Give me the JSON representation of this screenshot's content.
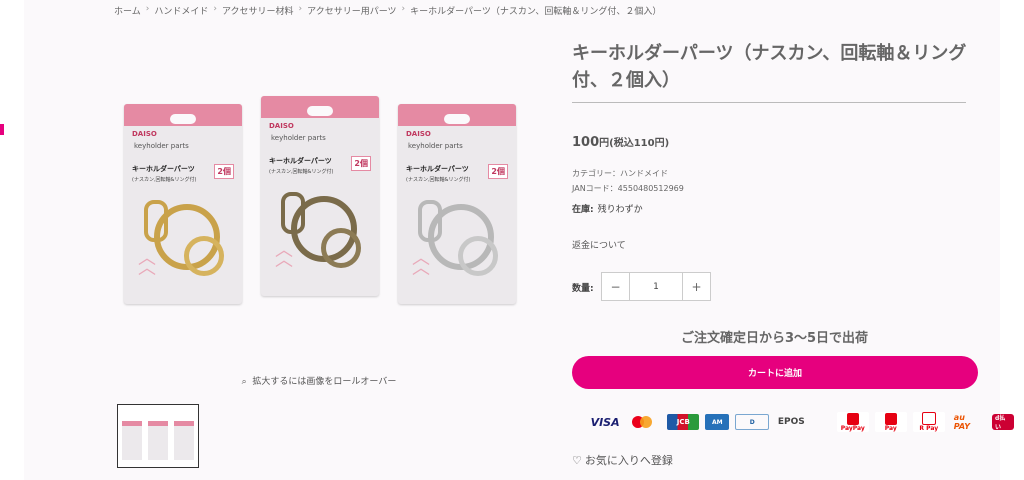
{
  "breadcrumb": [
    "ホーム",
    "ハンドメイド",
    "アクセサリー材料",
    "アクセサリー用パーツ",
    "キーホルダーパーツ（ナスカン、回転軸＆リング付、２個入）"
  ],
  "product": {
    "title": "キーホルダーパーツ（ナスカン、回転軸＆リング付、２個入）",
    "price": "100",
    "price_unit": "円",
    "price_tax": "(税込110円)",
    "category": "カテゴリー：ハンドメイド",
    "jan": "JANコード：4550480512969",
    "stock_label": "在庫:",
    "stock_value": "残りわずか",
    "refund_link": "返金について",
    "quantity_label": "数量:",
    "quantity_value": "1",
    "minus": "−",
    "plus": "+",
    "shipping_note": "ご注文確定日から3〜5日で出荷",
    "cart_button": "カートに追加",
    "favorite": "お気に入りへ登録"
  },
  "image": {
    "zoom_hint": "拡大するには画像をロールオーバー",
    "packs": [
      {
        "brand": "DAISO",
        "name": "keyholder parts",
        "label": "キーホルダーパーツ",
        "sub": "(ナスカン,回転軸&リング付)",
        "count": "2個",
        "metal": "#c9a24a"
      },
      {
        "brand": "DAISO",
        "name": "keyholder parts",
        "label": "キーホルダーパーツ",
        "sub": "(ナスカン,回転軸&リング付)",
        "count": "2個",
        "metal": "#7a6b4a"
      },
      {
        "brand": "DAISO",
        "name": "keyholder parts",
        "label": "キーホルダーパーツ",
        "sub": "(ナスカン,回転軸&リング付)",
        "count": "2個",
        "metal": "#b8b8b8"
      }
    ]
  },
  "payments": [
    {
      "name": "visa",
      "text": "VISA"
    },
    {
      "name": "mastercard",
      "text": ""
    },
    {
      "name": "jcb",
      "text": "JCB"
    },
    {
      "name": "amex",
      "text": "AM"
    },
    {
      "name": "diners",
      "text": "D"
    },
    {
      "name": "epos",
      "text": "EPOS"
    },
    {
      "name": "paypay",
      "text": "PayPay"
    },
    {
      "name": "rpay",
      "text": "Pay"
    },
    {
      "name": "rpay-2",
      "text": "R Pay"
    },
    {
      "name": "au-pay",
      "text": "au PAY"
    },
    {
      "name": "d-barai",
      "text": "d払い"
    }
  ],
  "colors": {
    "accent": "#e6007e",
    "background": "#fbf9fb"
  }
}
